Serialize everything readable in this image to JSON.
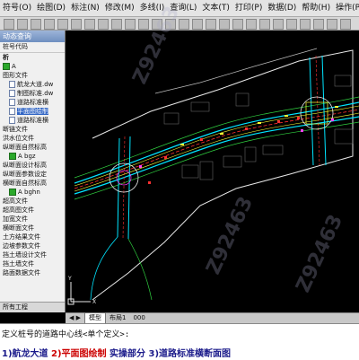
{
  "menubar": {
    "items": [
      "符号(W)",
      "土方",
      "线形",
      "平面",
      "平面编辑",
      "纵断",
      "横断",
      "交叉口",
      "无障碍",
      "表格",
      "图层",
      "工具",
      "标准标线",
      "文字",
      "帮助"
    ],
    "leading_partial": "绘图(D)",
    "second_row": [
      "符号(O)",
      "绘图(D)",
      "标注(N)",
      "修改(M)",
      "多线(I)",
      "查询(L)",
      "文本(T)",
      "打印(P)",
      "数据(D)",
      "帮助(H)",
      "操作(P)",
      "显示(V)"
    ]
  },
  "panel": {
    "title": "动态查询",
    "subtitle": "桩号代码",
    "header_tag": "析",
    "rows": [
      {
        "label": "A",
        "check": true,
        "indent": false
      },
      {
        "label": "图形文件",
        "check": false,
        "indent": false
      },
      {
        "label": "航龙大道.dw",
        "check": false,
        "indent": true,
        "doc": true
      },
      {
        "label": "制图标准.dw",
        "check": false,
        "indent": true,
        "doc": true
      },
      {
        "label": "道路标准横",
        "check": false,
        "indent": true,
        "doc": true
      },
      {
        "label": "平面图绘制",
        "check": false,
        "indent": true,
        "doc": true,
        "selected": true
      },
      {
        "label": "道路标准横",
        "check": false,
        "indent": true,
        "doc": true
      },
      {
        "label": "断链文件",
        "check": false,
        "indent": false
      },
      {
        "label": "洪水位文件",
        "check": false,
        "indent": false
      },
      {
        "label": "纵断面自然标高",
        "check": false,
        "indent": false
      },
      {
        "label": "A bgz",
        "check": true,
        "indent": true
      },
      {
        "label": "纵断面设计标高",
        "check": false,
        "indent": false
      },
      {
        "label": "纵断面参数设定",
        "check": false,
        "indent": false
      },
      {
        "label": "横断面自然标高",
        "check": false,
        "indent": false
      },
      {
        "label": "A bghn",
        "check": true,
        "indent": true
      },
      {
        "label": "超高文件",
        "check": false,
        "indent": false
      },
      {
        "label": "超高图文件",
        "check": false,
        "indent": false
      },
      {
        "label": "加宽文件",
        "check": false,
        "indent": false
      },
      {
        "label": "横断面文件",
        "check": false,
        "indent": false
      },
      {
        "label": "土方结果文件",
        "check": false,
        "indent": false
      },
      {
        "label": "边坡参数文件",
        "check": false,
        "indent": false
      },
      {
        "label": "挡土墙设计文件",
        "check": false,
        "indent": false
      },
      {
        "label": "挡土墙文件",
        "check": false,
        "indent": false
      },
      {
        "label": "路面数据文件",
        "check": false,
        "indent": false
      }
    ],
    "bottom_tab": "所有工程"
  },
  "tabs": {
    "nav": "◀ ▶",
    "items": [
      "模型",
      "布局1",
      "000"
    ]
  },
  "command": {
    "line1": "定义桩号的道路中心线<单个定义>:",
    "line2_parts": [
      {
        "text": "1)航龙大道",
        "color": "blue"
      },
      {
        "text": "2)平面图绘制",
        "color": "red"
      },
      {
        "text": "实操部分",
        "color": "blue"
      },
      {
        "text": "3)道路标准横断面图",
        "color": "blue"
      }
    ]
  },
  "watermark": "Z92463",
  "colors": {
    "road_edge": "#00e5ff",
    "road_center": "#ff3030",
    "road_line": "#ffff33",
    "green": "#30d040",
    "white": "#e8e8e8",
    "magenta": "#ff40ff"
  }
}
